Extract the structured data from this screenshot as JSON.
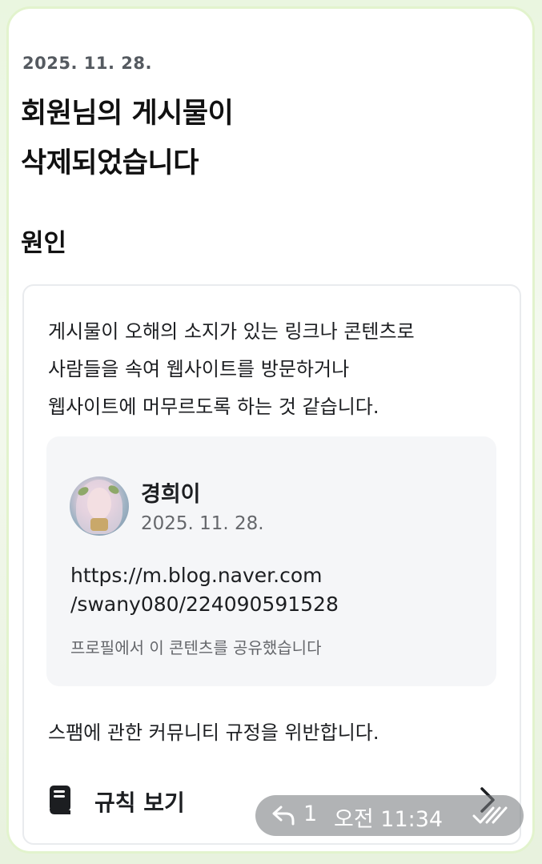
{
  "notice": {
    "date": "2025. 11. 28.",
    "title_lines": [
      "회원님의 게시물이",
      "삭제되었습니다"
    ],
    "section_heading": "원인"
  },
  "reason": {
    "lines": [
      "게시물이 오해의 소지가 있는 링크나 콘텐츠로",
      "사람들을 속여 웹사이트를 방문하거나",
      "웹사이트에 머무르도록 하는 것 같습니다."
    ],
    "shared_post": {
      "author": "경희이",
      "date": "2025. 11. 28.",
      "link_lines": [
        "https://m.blog.naver.com",
        "/swany080/224090591528"
      ],
      "note": "프로필에서 이 콘텐츠를 공유했습니다"
    },
    "violation": "스팸에 관한 커뮤니티 규정을 위반합니다.",
    "rules_link_label": "규칙 보기",
    "rules_icon": "book-icon",
    "chevron_icon": "chevron-right-icon"
  },
  "message_meta": {
    "reply_icon": "reply-icon",
    "reply_count": "1",
    "time": "오전 11:34",
    "read_icon": "double-check-icon"
  },
  "colors": {
    "frame_border": "#e2f3cd",
    "card_bg": "#ffffff",
    "shared_bg": "#f5f6f8",
    "muted_text": "#65676b",
    "overlay_bg": "#787c80"
  }
}
